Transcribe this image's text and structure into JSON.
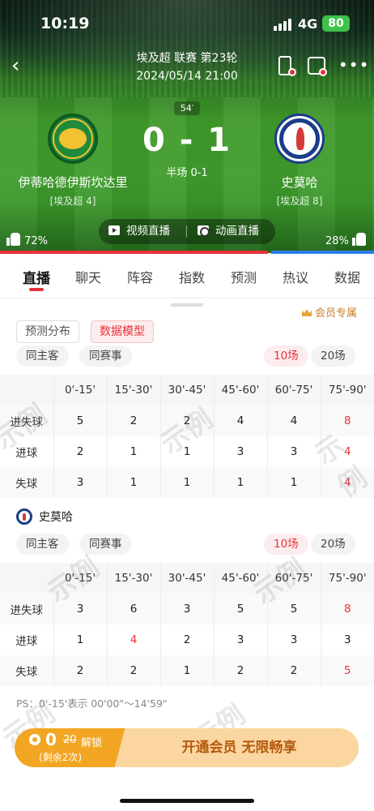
{
  "status_bar": {
    "time": "10:19",
    "network": "4G",
    "battery": "80"
  },
  "header": {
    "league_line": "埃及超 联赛 第23轮",
    "datetime": "2024/05/14 21:00"
  },
  "match": {
    "minute": "54′",
    "score": "0 - 1",
    "halftime": "半场 0-1",
    "home": {
      "name": "伊蒂哈德伊斯坎达里",
      "sub": "[埃及超 4]",
      "vote_pct": "72%"
    },
    "away": {
      "name": "史莫哈",
      "sub": "[埃及超 8]",
      "vote_pct": "28%"
    },
    "vote_home_fraction": 0.72
  },
  "live_buttons": {
    "video": "视频直播",
    "animation": "动画直播"
  },
  "tabs": [
    "直播",
    "聊天",
    "阵容",
    "指数",
    "预测",
    "热议",
    "数据"
  ],
  "vip_label": "会员专属",
  "segments": {
    "prediction": "预测分布",
    "data_model": "数据模型"
  },
  "filters": {
    "same_venue": "同主客",
    "same_comp": "同赛事",
    "last10": "10场",
    "last20": "20场"
  },
  "columns": [
    "",
    "0'-15'",
    "15'-30'",
    "30'-45'",
    "45'-60'",
    "60'-75'",
    "75'-90'"
  ],
  "home_table": {
    "rows": [
      {
        "label": "进失球",
        "values": [
          "5",
          "2",
          "2",
          "4",
          "4",
          "8"
        ]
      },
      {
        "label": "进球",
        "values": [
          "2",
          "1",
          "1",
          "3",
          "3",
          "4"
        ]
      },
      {
        "label": "失球",
        "values": [
          "3",
          "1",
          "1",
          "1",
          "1",
          "4"
        ]
      }
    ]
  },
  "away_team_label": "史莫哈",
  "away_table": {
    "rows": [
      {
        "label": "进失球",
        "values": [
          "3",
          "6",
          "3",
          "5",
          "5",
          "8"
        ]
      },
      {
        "label": "进球",
        "values": [
          "1",
          "4",
          "2",
          "3",
          "3",
          "3"
        ]
      },
      {
        "label": "失球",
        "values": [
          "2",
          "2",
          "1",
          "2",
          "2",
          "5"
        ]
      }
    ]
  },
  "note": "PS：0'-15'表示 00'00\"～14'59\"",
  "cta": {
    "price": "0",
    "original": "20",
    "unlock": "解锁",
    "remaining": "(剩余2次)",
    "membership": "开通会员 无限畅享"
  },
  "watermark": "示例",
  "colors": {
    "accent": "#e8323a",
    "away_blue": "#2b7de9",
    "vip_gold": "#c9812b",
    "cta_orange": "#f2a623"
  }
}
